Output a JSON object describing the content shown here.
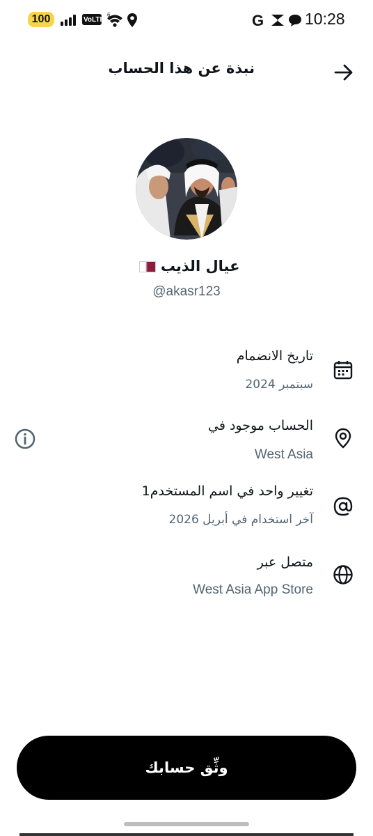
{
  "status_bar": {
    "battery": "100",
    "network_badge": "VoLTE",
    "wifi_badge": "6",
    "time": "10:28",
    "icons": [
      "battery-icon",
      "signal-icon",
      "volte-icon",
      "wifi-icon",
      "location-icon",
      "google-icon",
      "s-app-icon",
      "message-icon"
    ]
  },
  "header": {
    "title": "نبذة عن هذا الحساب",
    "back_icon": "arrow-right-icon"
  },
  "profile": {
    "display_name": "عيال الذيب",
    "flag": "qatar-flag",
    "username": "@akasr123"
  },
  "info_rows": [
    {
      "icon": "calendar-icon",
      "title": "تاريخ الانضمام",
      "value": "سبتمبر 2024"
    },
    {
      "icon": "location-pin-icon",
      "title": "الحساب موجود في",
      "value": "West Asia"
    },
    {
      "icon": "at-sign-icon",
      "title": "تغيير واحد في اسم المستخدم1",
      "value": "آخر استخدام في أبريل 2026"
    },
    {
      "icon": "globe-icon",
      "title": "متصل عبر",
      "value": "West Asia App Store"
    }
  ],
  "verify_button": {
    "label": "وثِّق حسابك"
  },
  "colors": {
    "text_primary": "#0f1419",
    "text_secondary": "#536471",
    "button_bg": "#000000",
    "battery_badge": "#f6d54a",
    "flag_maroon": "#8d1b3d"
  }
}
